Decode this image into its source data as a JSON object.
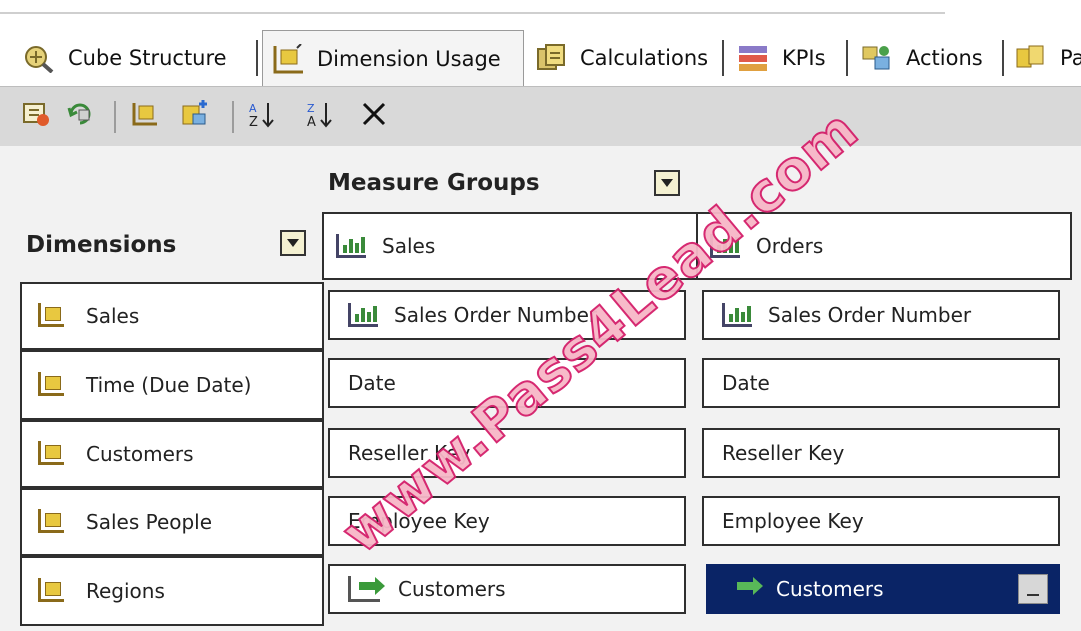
{
  "tabs": [
    {
      "label": "Cube Structure",
      "icon": "cube-structure-icon"
    },
    {
      "label": "Dimension Usage",
      "icon": "dimension-usage-icon",
      "active": true
    },
    {
      "label": "Calculations",
      "icon": "calculations-icon"
    },
    {
      "label": "KPIs",
      "icon": "kpis-icon"
    },
    {
      "label": "Actions",
      "icon": "actions-icon"
    },
    {
      "label": "Pa",
      "icon": "partitions-icon"
    }
  ],
  "toolbar": {
    "buttons": [
      "add-cube-dimension-icon",
      "define-relationship-icon",
      "show-dimension-icon",
      "show-measure-group-icon",
      "sort-ascending-icon",
      "sort-descending-icon",
      "delete-icon"
    ]
  },
  "headers": {
    "measure_groups": "Measure Groups",
    "dimensions": "Dimensions"
  },
  "measure_groups": [
    "Sales",
    "Orders"
  ],
  "dimensions": [
    "Sales",
    "Time (Due Date)",
    "Customers",
    "Sales People",
    "Regions"
  ],
  "grid": {
    "sales": [
      "Sales Order Number",
      "Date",
      "Reseller Key",
      "Employee Key",
      "Customers"
    ],
    "orders": [
      "Sales Order Number",
      "Date",
      "Reseller Key",
      "Employee Key",
      "Customers"
    ]
  },
  "watermark": "www.Pass4Lead.com",
  "colors": {
    "selection": "#0a2466",
    "toolbar": "#d9d9d9",
    "watermark": "#d41e6a"
  }
}
